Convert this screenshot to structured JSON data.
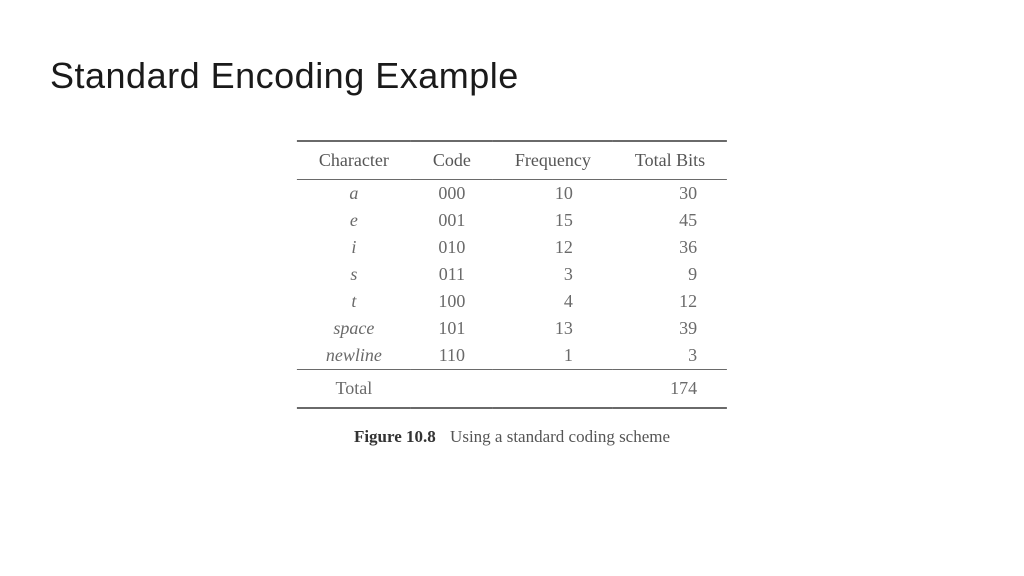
{
  "title": "Standard Encoding Example",
  "table": {
    "headers": {
      "character": "Character",
      "code": "Code",
      "frequency": "Frequency",
      "total_bits": "Total Bits"
    },
    "rows": [
      {
        "character": "a",
        "code": "000",
        "frequency": "10",
        "total_bits": "30"
      },
      {
        "character": "e",
        "code": "001",
        "frequency": "15",
        "total_bits": "45"
      },
      {
        "character": "i",
        "code": "010",
        "frequency": "12",
        "total_bits": "36"
      },
      {
        "character": "s",
        "code": "011",
        "frequency": "3",
        "total_bits": "9"
      },
      {
        "character": "t",
        "code": "100",
        "frequency": "4",
        "total_bits": "12"
      },
      {
        "character": "space",
        "code": "101",
        "frequency": "13",
        "total_bits": "39"
      },
      {
        "character": "newline",
        "code": "110",
        "frequency": "1",
        "total_bits": "3"
      }
    ],
    "footer": {
      "label": "Total",
      "total_bits": "174"
    }
  },
  "caption": {
    "label": "Figure 10.8",
    "text": "Using a standard coding scheme"
  }
}
